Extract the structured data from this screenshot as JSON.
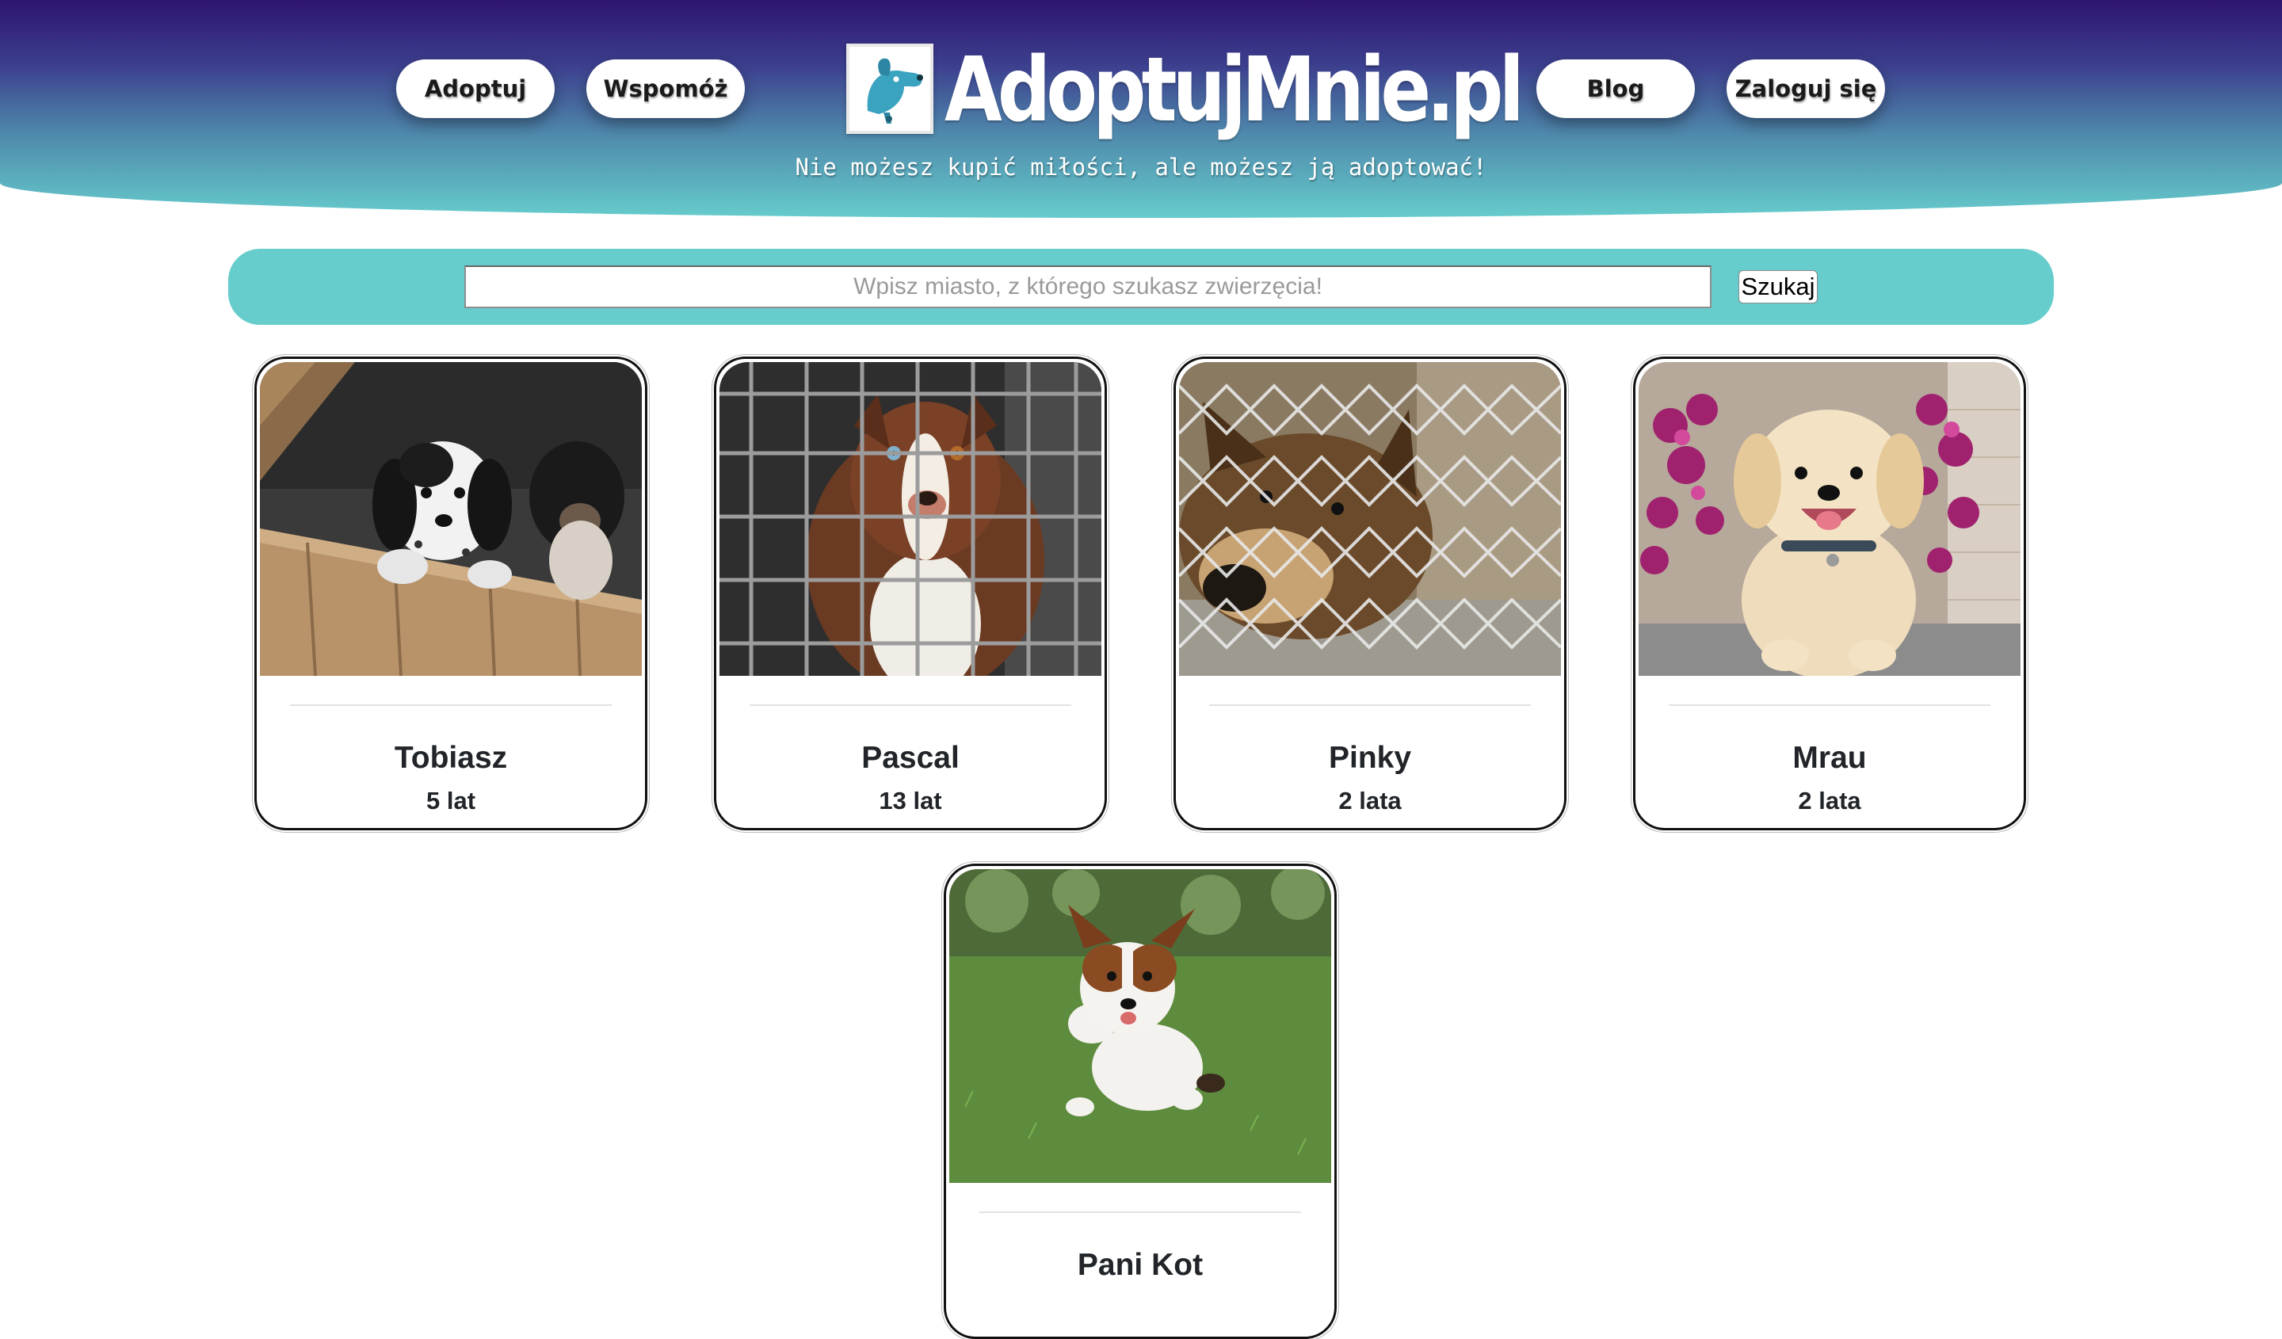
{
  "header": {
    "nav_left": [
      {
        "label": "Adoptuj"
      },
      {
        "label": "Wspomóż"
      }
    ],
    "nav_right": [
      {
        "label": "Blog"
      },
      {
        "label": "Zaloguj się"
      }
    ],
    "logo_text": "AdoptujMnie.pl",
    "logo_icon": "dog-head-icon",
    "tagline": "Nie możesz kupić miłości, ale możesz ją adoptować!"
  },
  "search": {
    "placeholder": "Wpisz miasto, z którego szukasz zwierzęcia!",
    "value": "",
    "button_label": "Szukaj"
  },
  "colors": {
    "header_top": "#2e1470",
    "header_bottom": "#66cccc",
    "search_bar": "#66cccc",
    "card_border": "#111111"
  },
  "pets": [
    {
      "name": "Tobiasz",
      "age": "5 lat"
    },
    {
      "name": "Pascal",
      "age": "13 lat"
    },
    {
      "name": "Pinky",
      "age": "2 lata"
    },
    {
      "name": "Mrau",
      "age": "2 lata"
    },
    {
      "name": "Pani Kot",
      "age": ""
    }
  ]
}
